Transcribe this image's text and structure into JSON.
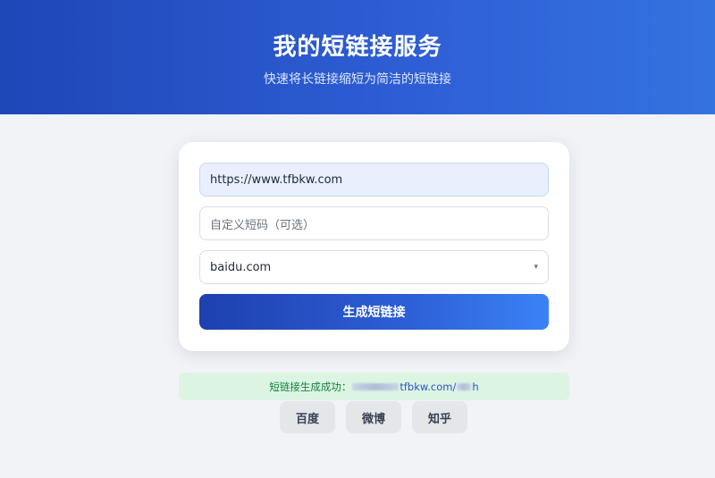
{
  "header": {
    "title": "我的短链接服务",
    "subtitle": "快速将长链接缩短为简洁的短链接"
  },
  "form": {
    "url_value": "https://www.tfbkw.com",
    "custom_placeholder": "自定义短码（可选）",
    "domain_selected": "baidu.com",
    "submit_label": "生成短链接"
  },
  "result": {
    "prefix": "短链接生成成功：",
    "link_visible": "tfbkw.com/",
    "link_tail": "h"
  },
  "share": {
    "buttons": [
      "百度",
      "微博",
      "知乎"
    ]
  },
  "colors": {
    "header_start": "#1e47b8",
    "header_end": "#3473e0",
    "button_start": "#1e40af",
    "button_end": "#3b82f6",
    "success_bg": "#dcf5e3",
    "success_text": "#15803d"
  }
}
